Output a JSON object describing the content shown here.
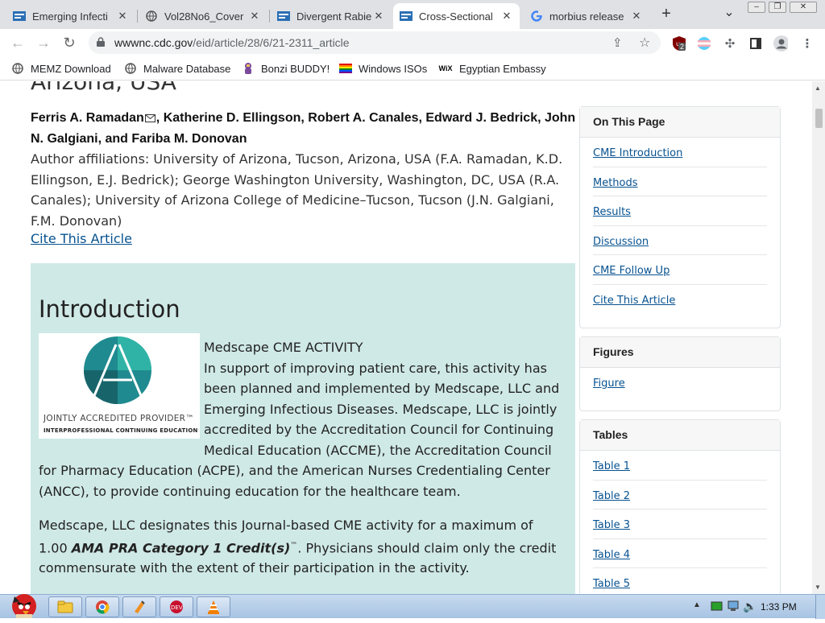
{
  "browser": {
    "tabs": [
      {
        "title": "Emerging Infecti",
        "icon": "cdc-favicon",
        "active": false
      },
      {
        "title": "Vol28No6_Cover",
        "icon": "globe-favicon",
        "active": false
      },
      {
        "title": "Divergent Rabie",
        "icon": "cdc-favicon",
        "active": false
      },
      {
        "title": "Cross-Sectional",
        "icon": "cdc-favicon",
        "active": true
      },
      {
        "title": "morbius release",
        "icon": "google-favicon",
        "active": false
      }
    ],
    "new_tab": "+",
    "tab_list": "⌄",
    "close_glyph": "✕",
    "url_host": "wwwnc.cdc.gov",
    "url_path": "/eid/article/28/6/21-2311_article",
    "extension_badge": "2",
    "bookmarks": [
      {
        "label": "MEMZ Download",
        "icon": "globe-icon"
      },
      {
        "label": "Malware Database",
        "icon": "globe-icon"
      },
      {
        "label": "Bonzi BUDDY!",
        "icon": "bonzi-icon"
      },
      {
        "label": "Windows ISOs",
        "icon": "rainbow-flag-icon"
      },
      {
        "label": "Egyptian Embassy",
        "icon": "wix-icon"
      }
    ]
  },
  "article": {
    "title_partial": "Arizona, USA",
    "authors_main": "Ferris A. Ramadan",
    "authors_rest": ", Katherine D. Ellingson, Robert A. Canales, Edward J. Bedrick, John N. Galgiani, and Fariba M. Donovan",
    "affiliations": "Author affiliations: University of Arizona, Tucson, Arizona, USA (F.A. Ramadan, K.D. Ellingson, E.J. Bedrick); George Washington University, Washington, DC, USA (R.A. Canales); University of Arizona College of Medicine–Tucson, Tucson (J.N. Galgiani, F.M. Donovan)",
    "cite_link": "Cite This Article",
    "intro_heading": "Introduction",
    "jap_logo_line1": "JOINTLY ACCREDITED PROVIDER™",
    "jap_logo_line2": "INTERPROFESSIONAL CONTINUING EDUCATION",
    "cme_activity": "Medscape CME ACTIVITY",
    "cme_para1": "In support of improving patient care, this activity has been planned and implemented by Medscape, LLC and Emerging Infectious Diseases. Medscape, LLC is jointly accredited by the Accreditation Council for Continuing Medical Education (ACCME), the Accreditation Council for Pharmacy Education (ACPE), and the American Nurses Credentialing Center (ANCC), to provide continuing education for the healthcare team.",
    "cme_para2_a": "Medscape, LLC designates this Journal-based CME activity for a maximum of 1.00 ",
    "cme_para2_b": "AMA PRA Category 1 Credit(s)",
    "cme_para2_tm": "™",
    "cme_para2_c": ". Physicians should claim only the credit commensurate with the extent of their participation in the activity."
  },
  "sidebar": {
    "on_this_page": {
      "heading": "On This Page",
      "links": [
        "CME Introduction",
        "Methods",
        "Results",
        "Discussion",
        "CME Follow Up",
        "Cite This Article"
      ]
    },
    "figures": {
      "heading": "Figures",
      "links": [
        "Figure"
      ]
    },
    "tables": {
      "heading": "Tables",
      "links": [
        "Table 1",
        "Table 2",
        "Table 3",
        "Table 4",
        "Table 5"
      ]
    }
  },
  "taskbar": {
    "clock": "1:33 PM",
    "apps": [
      "explorer-icon",
      "chrome-icon",
      "winamp-icon",
      "devcpp-icon",
      "vlc-icon"
    ]
  },
  "colors": {
    "accent_link": "#075290",
    "cme_bg": "#cfe9e6",
    "tab_strip": "#dfe1e5"
  }
}
